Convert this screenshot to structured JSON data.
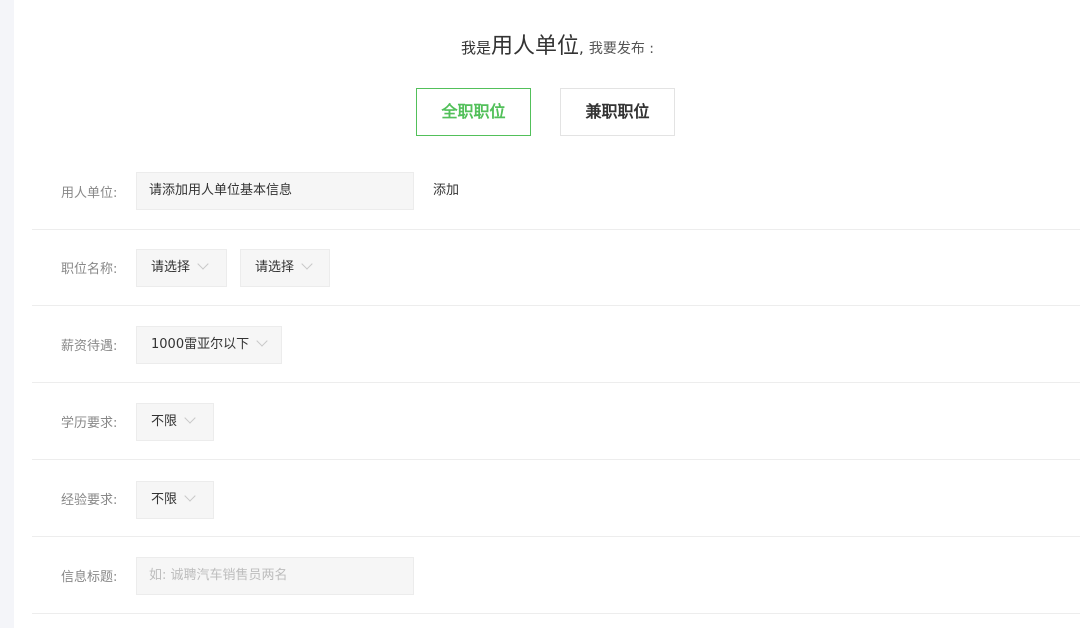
{
  "heading": {
    "prefix": "我是",
    "role": "用人单位",
    "suffix": ",",
    "tail": "我要发布 :"
  },
  "job_types": {
    "full_time": "全职职位",
    "part_time": "兼职职位",
    "active": "full_time"
  },
  "form": {
    "employer": {
      "label": "用人单位:",
      "value": "请添加用人单位基本信息",
      "add_label": "添加"
    },
    "position": {
      "label": "职位名称:",
      "select1": "请选择",
      "select2": "请选择"
    },
    "salary": {
      "label": "薪资待遇:",
      "value": "1000雷亚尔以下"
    },
    "education": {
      "label": "学历要求:",
      "value": "不限"
    },
    "experience": {
      "label": "经验要求:",
      "value": "不限"
    },
    "title": {
      "label": "信息标题:",
      "placeholder": "如: 诚聘汽车销售员两名"
    }
  },
  "colors": {
    "accent": "#52c05a",
    "field_bg": "#f6f6f6",
    "label": "#888888"
  }
}
